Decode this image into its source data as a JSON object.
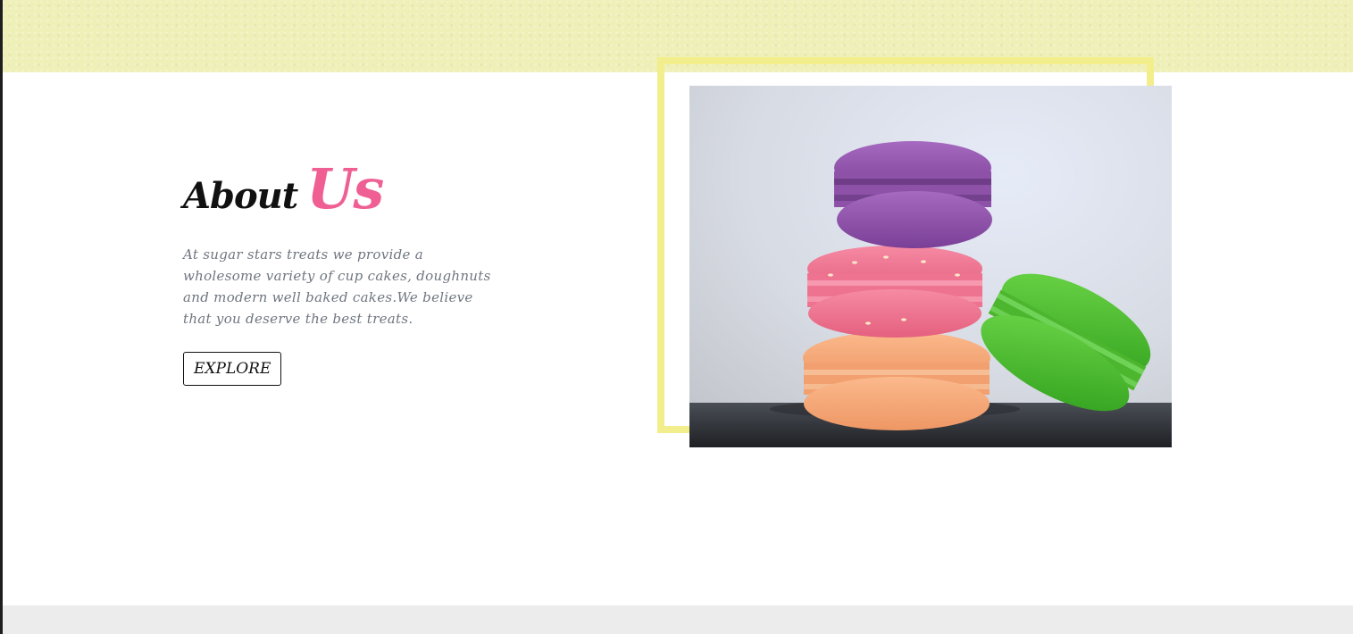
{
  "about": {
    "title_first": "About",
    "title_second": "Us",
    "description": "At sugar stars treats we provide a wholesome variety of cup cakes, doughnuts and modern well baked cakes.We believe that you deserve the best treats.",
    "explore_label": "EXPLORE"
  },
  "colors": {
    "top_band": "#efefb8",
    "accent_pink": "#ef5f94",
    "frame_yellow": "#f3ee8c",
    "footer_band": "#ececec",
    "text_gray": "#6f7680"
  },
  "image": {
    "subject": "stack of macarons (purple, pink, orange) with green macaron leaning"
  }
}
